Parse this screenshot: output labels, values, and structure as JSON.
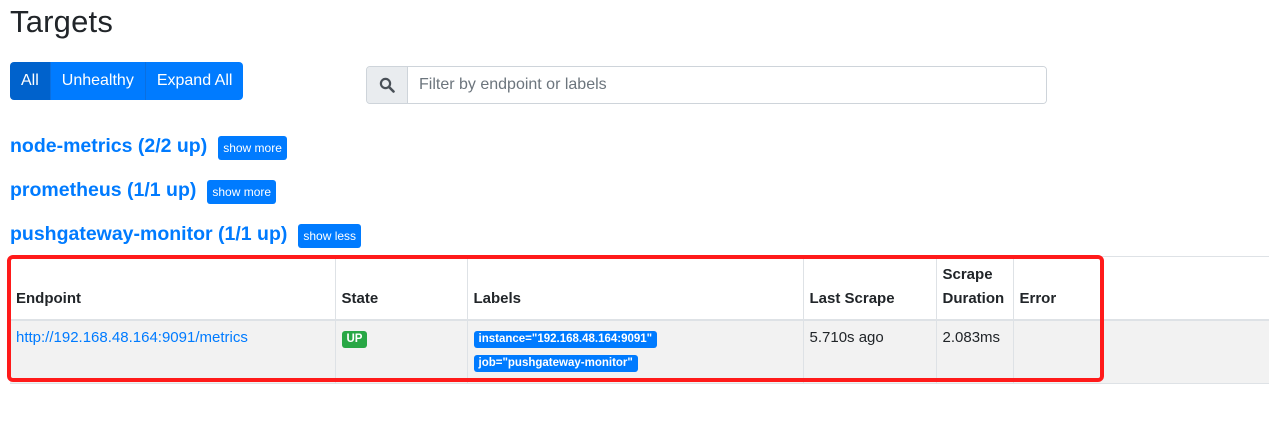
{
  "page": {
    "title": "Targets"
  },
  "filters": {
    "all_label": "All",
    "unhealthy_label": "Unhealthy",
    "expand_label": "Expand All"
  },
  "search": {
    "placeholder": "Filter by endpoint or labels"
  },
  "pools": [
    {
      "name": "node-metrics (2/2 up)",
      "toggle": "show more"
    },
    {
      "name": "prometheus (1/1 up)",
      "toggle": "show more"
    },
    {
      "name": "pushgateway-monitor (1/1 up)",
      "toggle": "show less"
    }
  ],
  "table": {
    "headers": {
      "endpoint": "Endpoint",
      "state": "State",
      "labels": "Labels",
      "last_scrape": "Last Scrape",
      "scrape_duration_line1": "Scrape",
      "scrape_duration_line2": "Duration",
      "error": "Error"
    },
    "rows": [
      {
        "endpoint": "http://192.168.48.164:9091/metrics",
        "state": "UP",
        "labels": [
          "instance=\"192.168.48.164:9091\"",
          "job=\"pushgateway-monitor\""
        ],
        "last_scrape": "5.710s ago",
        "scrape_duration": "2.083ms",
        "error": ""
      }
    ]
  },
  "colors": {
    "primary": "#007bff",
    "success": "#28a745",
    "highlight": "#ff1a1a"
  }
}
